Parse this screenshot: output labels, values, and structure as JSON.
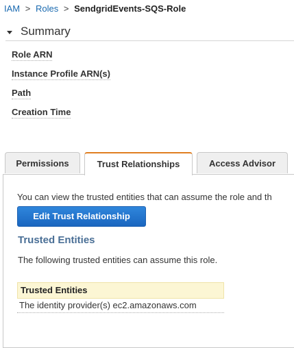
{
  "breadcrumb": {
    "items": [
      "IAM",
      "Roles"
    ],
    "separator": ">",
    "current": "SendgridEvents-SQS-Role"
  },
  "summary": {
    "title": "Summary",
    "fields": [
      "Role ARN",
      "Instance Profile ARN(s)",
      "Path",
      "Creation Time"
    ]
  },
  "tabs": [
    {
      "label": "Permissions",
      "active": false
    },
    {
      "label": "Trust Relationships",
      "active": true
    },
    {
      "label": "Access Advisor",
      "active": false
    }
  ],
  "trust": {
    "description": "You can view the trusted entities that can assume the role and th",
    "edit_button": "Edit Trust Relationship",
    "heading": "Trusted Entities",
    "subdescription": "The following trusted entities can assume this role.",
    "table": {
      "header": "Trusted Entities",
      "rows": [
        "The identity provider(s) ec2.amazonaws.com"
      ]
    }
  },
  "colors": {
    "link": "#1a6ab0",
    "button": "#1a66bf",
    "active_tab_accent": "#e07e20",
    "heading": "#4a6f96",
    "table_header": "#fcf6d4"
  }
}
